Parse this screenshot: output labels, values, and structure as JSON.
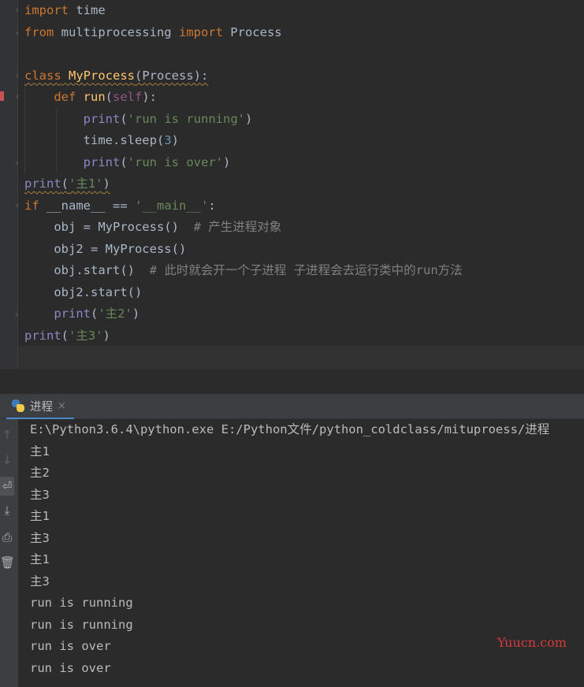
{
  "editor": {
    "lines": [
      {
        "kw1": "import",
        "rest": " time"
      },
      {
        "kw1": "from",
        "mid": " multiprocessing ",
        "kw2": "import",
        "rest": " Process"
      },
      {},
      {
        "kw1": "class",
        "name": " MyProcess",
        "rest": "(Process):"
      },
      {
        "indent": "    ",
        "kw1": "def",
        "name": " run",
        "open": "(",
        "self": "self",
        "close": "):"
      },
      {
        "indent": "        ",
        "bi": "print",
        "open": "(",
        "str": "'run is running'",
        "close": ")"
      },
      {
        "indent": "        ",
        "pre": "time.sleep(",
        "num": "3",
        "close": ")"
      },
      {
        "indent": "        ",
        "bi": "print",
        "open": "(",
        "str": "'run is over'",
        "close": ")"
      },
      {
        "bi": "print",
        "open": "(",
        "str": "'主1'",
        "close": ")"
      },
      {
        "kw1": "if",
        "mid": " __name__ == ",
        "str": "'__main__'",
        "close": ":"
      },
      {
        "indent": "    ",
        "code": "obj = MyProcess()  ",
        "cmt": "# 产生进程对象"
      },
      {
        "indent": "    ",
        "code": "obj2 = MyProcess()"
      },
      {
        "indent": "    ",
        "code": "obj.start()  ",
        "cmt": "# 此时就会开一个子进程 子进程会去运行类中的run方法"
      },
      {
        "indent": "    ",
        "code": "obj2.start()"
      },
      {
        "indent": "    ",
        "bi": "print",
        "open": "(",
        "str": "'主2'",
        "close": ")"
      },
      {
        "bi": "print",
        "open": "(",
        "str": "'主3'",
        "close": ")"
      }
    ]
  },
  "run_panel": {
    "tab_label": "进程",
    "close_glyph": "×",
    "command": "E:\\Python3.6.4\\python.exe E:/Python文件/python_coldclass/mituproess/进程",
    "output": [
      "主1",
      "主2",
      "主3",
      "主1",
      "主3",
      "主1",
      "主3",
      "run is running",
      "run is running",
      "run is over",
      "run is over"
    ]
  },
  "tools": {
    "up": "↑",
    "down": "↓",
    "wrap": "⏎",
    "scroll_end": "⤓",
    "print": "⎙",
    "trash": "🗑"
  },
  "watermark": "Yuucn.com",
  "colors": {
    "keyword": "#cc7832",
    "function": "#ffc66d",
    "string": "#6a8759",
    "number": "#6897bb",
    "self": "#94558d",
    "builtin": "#8888c6",
    "comment": "#808080"
  }
}
